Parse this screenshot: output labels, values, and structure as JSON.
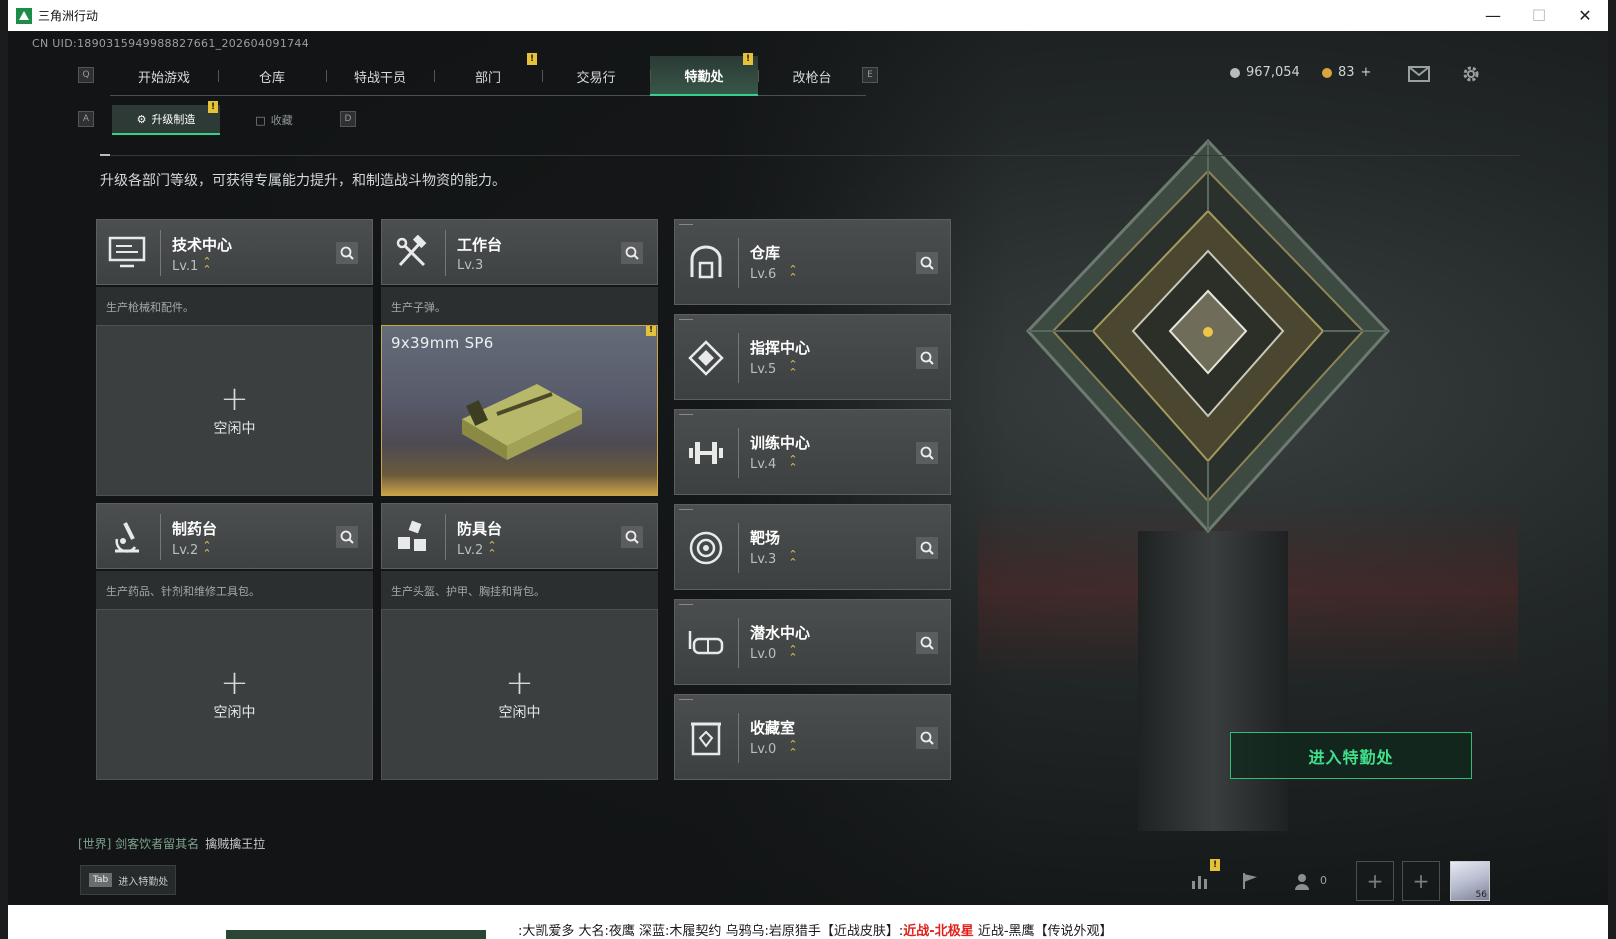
{
  "window": {
    "title": "三角洲行动"
  },
  "uid": "CN UID:1890315949988827661_202604091744",
  "topnav": {
    "left_key": "Q",
    "right_key": "E",
    "tabs": [
      {
        "label": "开始游戏",
        "badge": ""
      },
      {
        "label": "仓库",
        "badge": ""
      },
      {
        "label": "特战干员",
        "badge": ""
      },
      {
        "label": "部门",
        "badge": "!"
      },
      {
        "label": "交易行",
        "badge": ""
      },
      {
        "label": "特勤处",
        "badge": "!",
        "active": true
      },
      {
        "label": "改枪台",
        "badge": ""
      }
    ]
  },
  "currency": {
    "coins": "967,054",
    "tokens": "83",
    "tokens_add": "+"
  },
  "subtabs": {
    "left_key": "A",
    "right_key": "D",
    "items": [
      {
        "label": "升级制造",
        "badge": "!",
        "active": true
      },
      {
        "label": "收藏",
        "badge": ""
      }
    ]
  },
  "description": "升级各部门等级，可获得专属能力提升，和制造战斗物资的能力。",
  "workshops": [
    {
      "name": "技术中心",
      "level": "Lv.1",
      "desc": "生产枪械和配件。",
      "status": "空闲中",
      "icon": "monitor-icon"
    },
    {
      "name": "工作台",
      "level": "Lv.3",
      "desc": "生产子弹。",
      "product": "9x39mm SP6",
      "icon": "tools-icon"
    },
    {
      "name": "制药台",
      "level": "Lv.2",
      "desc": "生产药品、针剂和维修工具包。",
      "status": "空闲中",
      "icon": "microscope-icon"
    },
    {
      "name": "防具台",
      "level": "Lv.2",
      "desc": "生产头盔、护甲、胸挂和背包。",
      "status": "空闲中",
      "icon": "armor-icon"
    }
  ],
  "facilities": [
    {
      "name": "仓库",
      "level": "Lv.6",
      "icon": "warehouse-icon"
    },
    {
      "name": "指挥中心",
      "level": "Lv.5",
      "icon": "command-icon"
    },
    {
      "name": "训练中心",
      "level": "Lv.4",
      "icon": "dumbbell-icon"
    },
    {
      "name": "靶场",
      "level": "Lv.3",
      "icon": "target-icon"
    },
    {
      "name": "潜水中心",
      "level": "Lv.0",
      "icon": "diving-mask-icon"
    },
    {
      "name": "收藏室",
      "level": "Lv.0",
      "icon": "collection-icon"
    }
  ],
  "enter_button": "进入特勤处",
  "chat": {
    "channel": "[世界] 剑客饮者留其名",
    "message": "擒贼擒王拉"
  },
  "tab_hint": {
    "key": "Tab",
    "label": "进入特勤处"
  },
  "friends_count": "0",
  "avatar_level": "56",
  "ticker": {
    "part1": ":大凯爱多 大名:夜鹰 深蓝:木履契约 乌鸦乌:岩原猎手【近战皮肤】:",
    "part2": "近战-北极星",
    "part3": " 近战-黑鹰【传说外观】"
  },
  "colors": {
    "accent": "#35d18a",
    "badge": "#e6c238",
    "chevron": "#e5c04a"
  }
}
